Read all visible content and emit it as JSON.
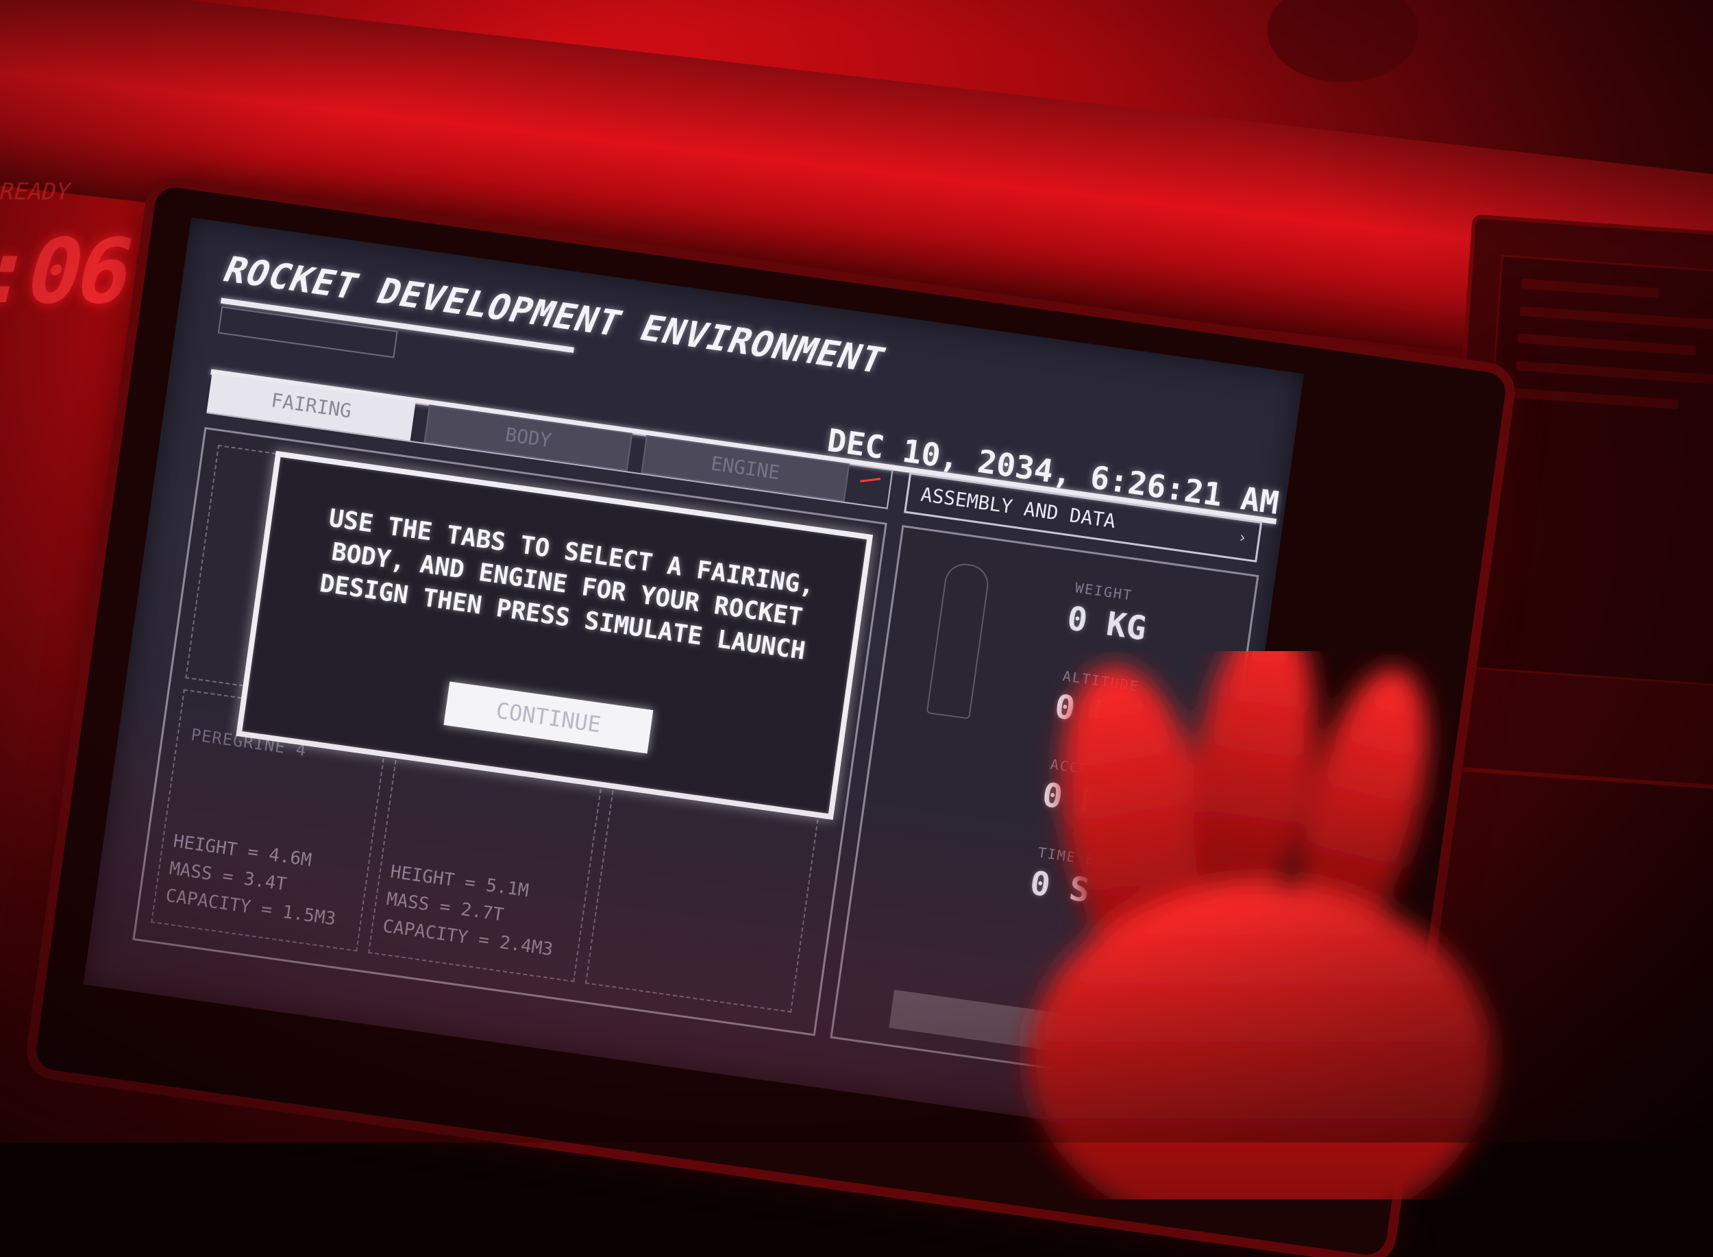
{
  "screen": {
    "title": "ROCKET DEVELOPMENT ENVIRONMENT",
    "datetime": "DEC 10, 2034, 6:26:21 AM",
    "path": "",
    "tabs": [
      {
        "label": "FAIRING",
        "active": true
      },
      {
        "label": "BODY",
        "active": false
      },
      {
        "label": "ENGINE",
        "active": false
      }
    ],
    "left_panel": {
      "item_label": "PEREGRINE 4",
      "specs_a": "HEIGHT = 4.6M\nMASS = 3.4T\nCAPACITY = 1.5M3",
      "specs_b": "HEIGHT = 5.1M\nMASS = 2.7T\nCAPACITY = 2.4M3"
    },
    "assembly": {
      "header": "ASSEMBLY AND DATA",
      "chevron_icon": "chevron-right-icon",
      "stats": [
        {
          "label": "WEIGHT",
          "value": "0 KG"
        },
        {
          "label": "ALTITUDE",
          "value": "0 M"
        },
        {
          "label": "ACCELERATION",
          "value": "0 M/S"
        },
        {
          "label": "TIME ELAPSED",
          "value": "0 S"
        }
      ]
    },
    "modal": {
      "message": "USE THE TABS TO SELECT A FAIRING, BODY, AND ENGINE FOR YOUR ROCKET DESIGN THEN PRESS SIMULATE LAUNCH",
      "button_label": "CONTINUE"
    }
  },
  "bezel": {
    "timer": ":06",
    "caption": "READY"
  },
  "colors": {
    "ambient_red": "#d40d14",
    "screen_bg": "#2a2838",
    "screen_text": "#f2f2f8"
  }
}
